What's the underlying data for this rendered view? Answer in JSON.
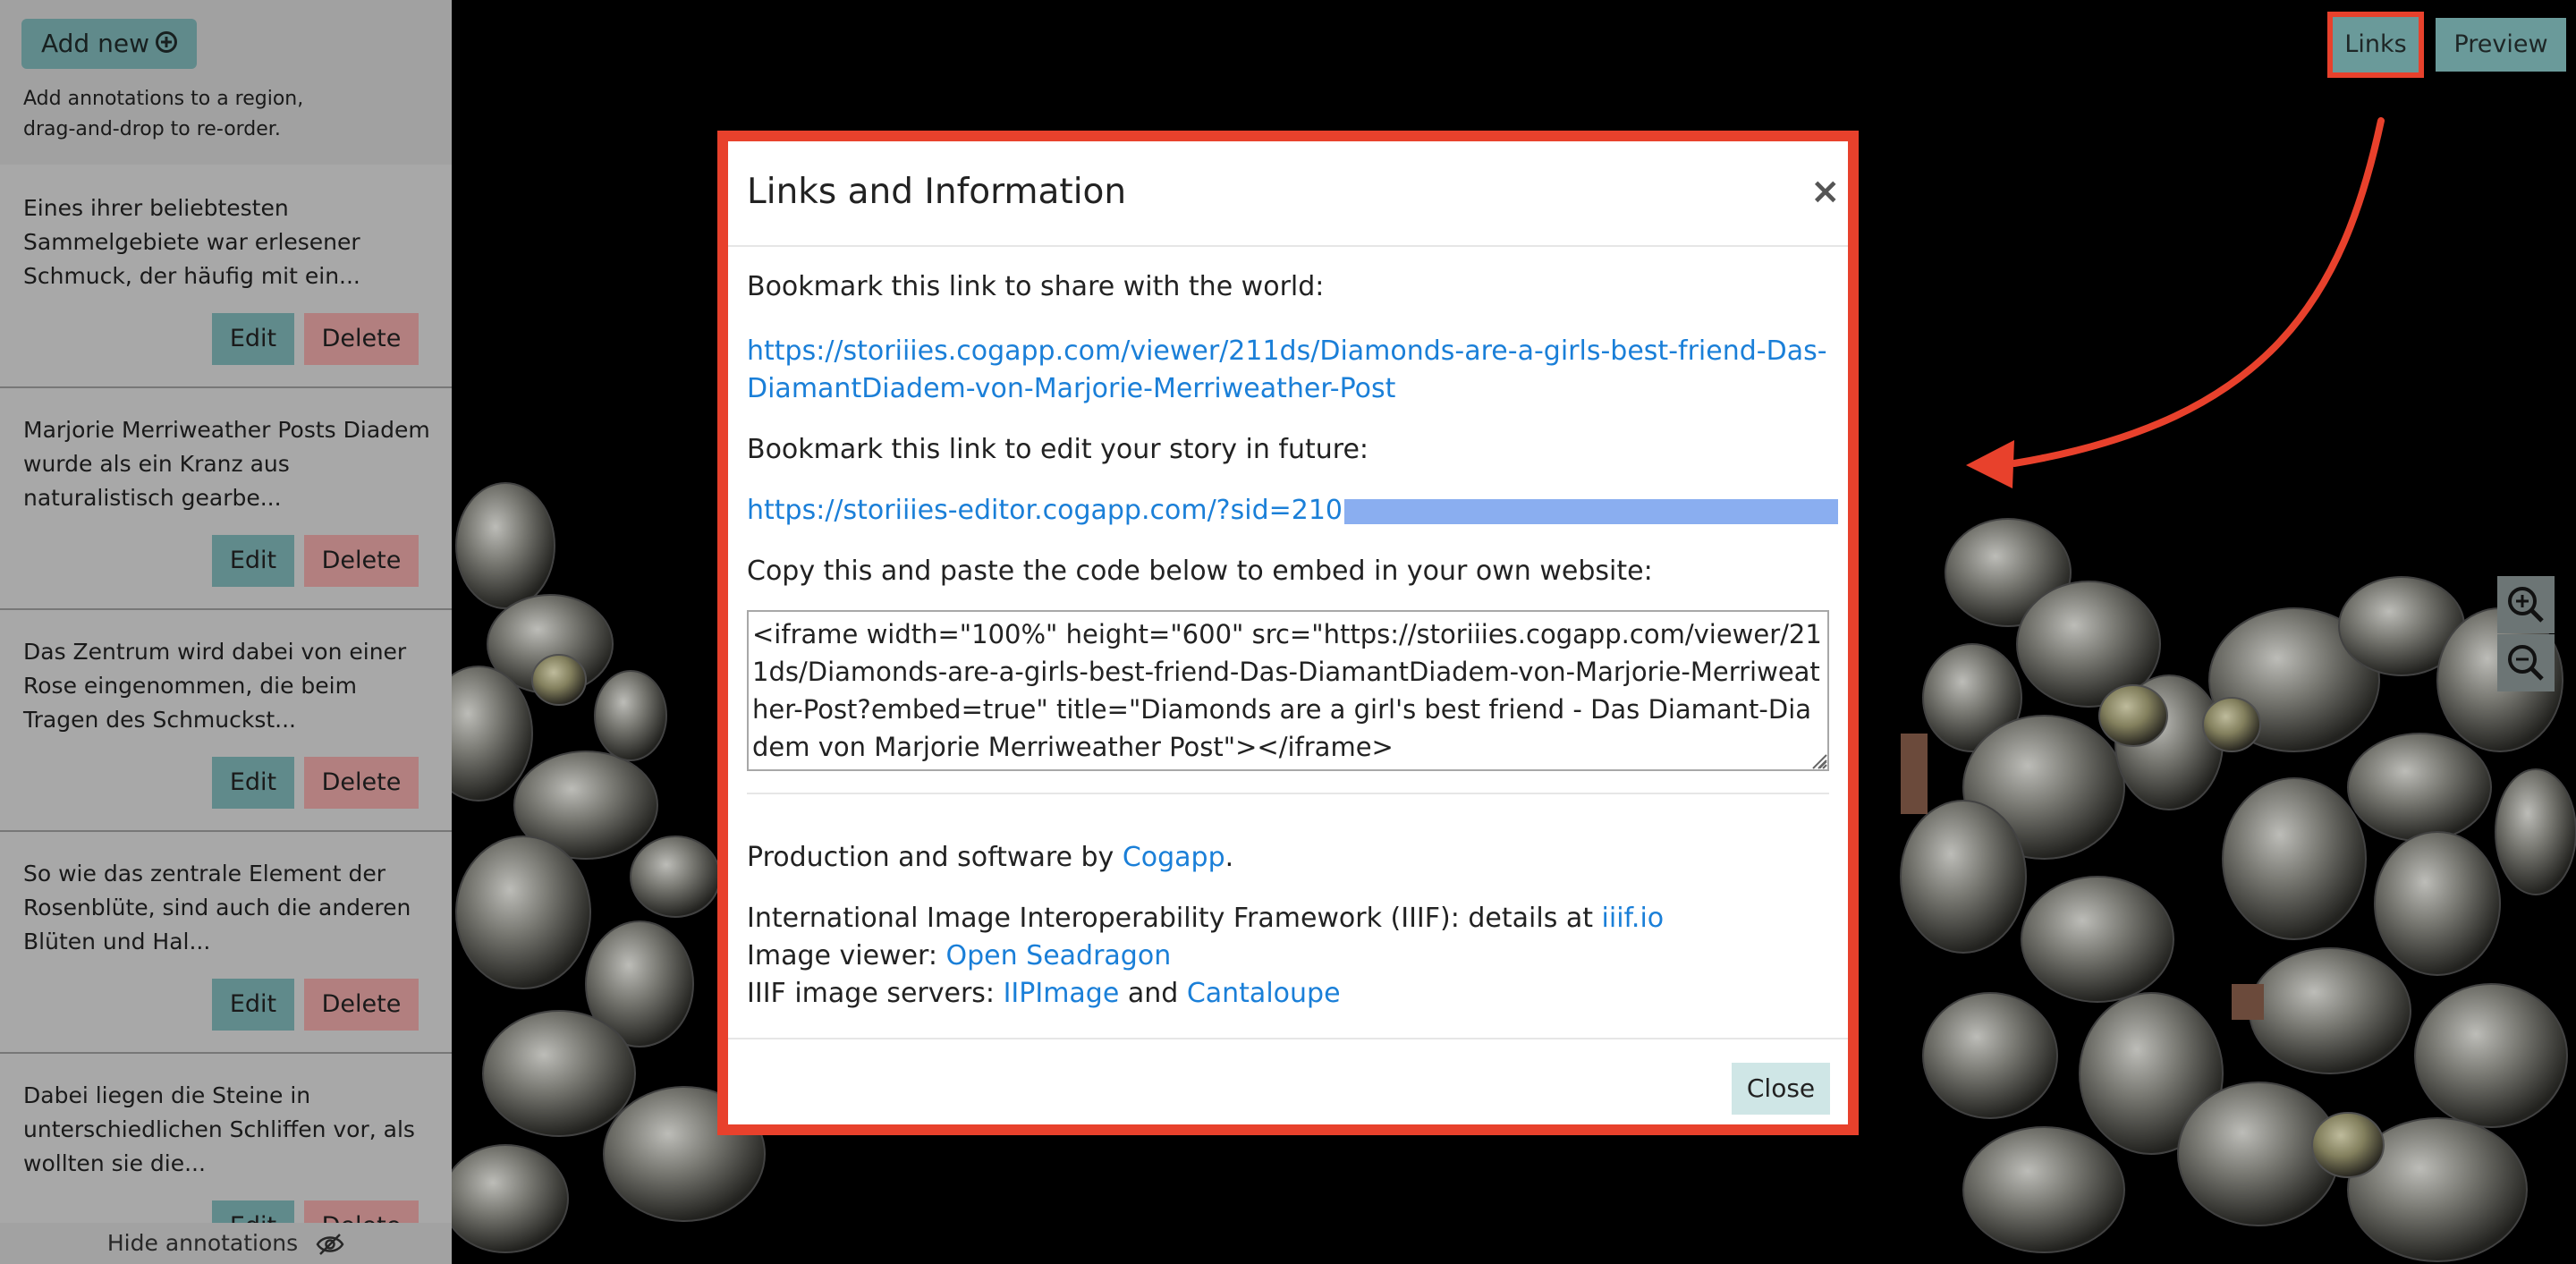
{
  "sidebar": {
    "add_new_label": "Add new",
    "help_line1": "Add annotations to a region,",
    "help_line2": "drag-and-drop to re-order.",
    "items": [
      {
        "text": "Eines ihrer beliebtesten Sammelgebiete war erlesener Schmuck, der häufig mit ein...",
        "edit": "Edit",
        "delete": "Delete"
      },
      {
        "text": "Marjorie Merriweather Posts Diadem wurde als ein Kranz aus naturalistisch gearbe...",
        "edit": "Edit",
        "delete": "Delete"
      },
      {
        "text": "Das Zentrum wird dabei von einer Rose eingenommen, die beim Tragen des Schmuckst...",
        "edit": "Edit",
        "delete": "Delete"
      },
      {
        "text": "So wie das zentrale Element der Rosenblüte, sind auch die anderen Blüten und Hal...",
        "edit": "Edit",
        "delete": "Delete"
      },
      {
        "text": "Dabei liegen die Steine in unterschiedlichen Schliffen vor, als wollten sie die...",
        "edit": "Edit",
        "delete": "Delete"
      }
    ],
    "hide_annotations_label": "Hide annotations"
  },
  "toolbar": {
    "links_label": "Links",
    "preview_label": "Preview"
  },
  "modal": {
    "title": "Links and Information",
    "close_x": "×",
    "share_prompt": "Bookmark this link to share with the world:",
    "share_url": "https://storiiies.cogapp.com/viewer/211ds/Diamonds-are-a-girls-best-friend-Das-DiamantDiadem-von-Marjorie-Merriweather-Post",
    "edit_prompt": "Bookmark this link to edit your story in future:",
    "edit_url_visible": "https://storiiies-editor.cogapp.com/?sid=210",
    "embed_prompt": "Copy this and paste the code below to embed in your own website:",
    "embed_code": "<iframe width=\"100%\" height=\"600\" src=\"https://storiiies.cogapp.com/viewer/211ds/Diamonds-are-a-girls-best-friend-Das-DiamantDiadem-von-Marjorie-Merriweather-Post?embed=true\" title=\"Diamonds are a girl's best friend - Das Diamant-Diadem von Marjorie Merriweather Post\"></iframe>",
    "production_prefix": "Production and software by ",
    "production_link": "Cogapp",
    "production_suffix": ".",
    "iiif_prefix": "International Image Interoperability Framework (IIIF): details at ",
    "iiif_link": "iiif.io",
    "viewer_prefix": "Image viewer: ",
    "viewer_link": "Open Seadragon",
    "servers_prefix": "IIIF image servers: ",
    "servers_link1": "IIPImage",
    "servers_and": " and ",
    "servers_link2": "Cantaloupe",
    "close_label": "Close"
  },
  "colors": {
    "highlight_red": "#e8412c",
    "link_blue": "#1a7fd8",
    "teal_button": "#7bb1b2",
    "delete_pink": "#e4a3a3"
  }
}
